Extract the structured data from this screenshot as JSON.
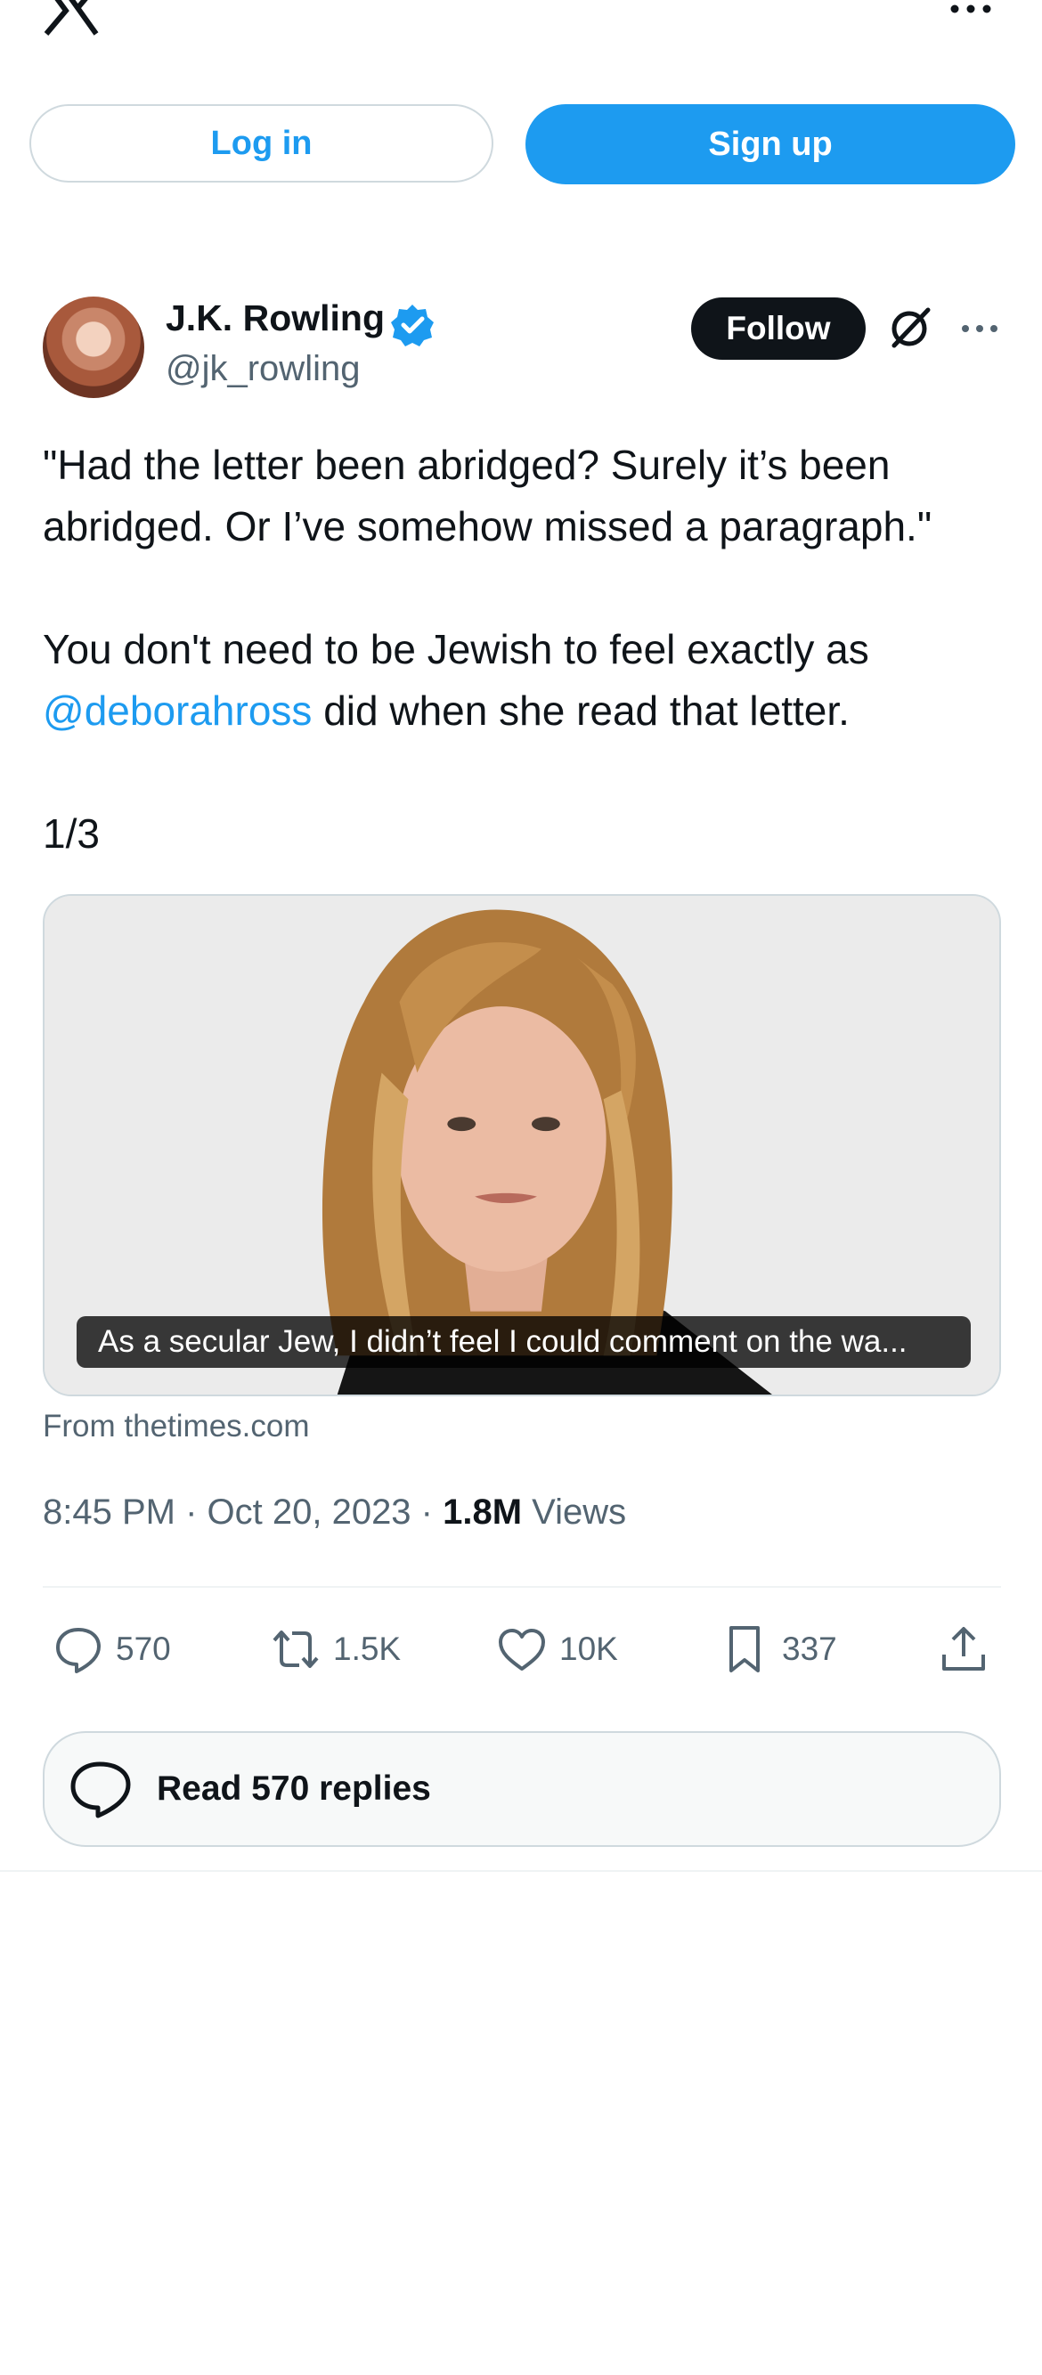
{
  "top_bar": {
    "logo_icon": "x-logo-icon",
    "more_icon": "more-horizontal-icon",
    "login_label": "Log in",
    "signup_label": "Sign up",
    "accent_color": "#1d9bf0"
  },
  "tweet": {
    "author_name": "J.K. Rowling",
    "handle": "@jk_rowling",
    "verified_icon": "verified-badge-icon",
    "follow_label": "Follow",
    "grok_icon": "grok-icon",
    "more_icon": "more-horizontal-icon",
    "text_line1": "\"Had the letter been abridged? Surely it’s been abridged. Or I’ve somehow missed a paragraph.\"",
    "text_line2_prefix": "You don't need to be Jewish to feel exactly as ",
    "mention": "@deborahross",
    "text_line2_suffix": " did when she read that letter.",
    "thread_marker": "1/3",
    "card_caption": "As a secular Jew, I didn’t feel I could comment on the wa...",
    "card_source": "From thetimes.com",
    "time": "8:45 PM · Oct 20, 2023 · ",
    "views_count": "1.8M",
    "views_label": " Views"
  },
  "actions": {
    "replies": "570",
    "retweets": "1.5K",
    "likes": "10K",
    "bookmarks": "337",
    "reply_icon": "reply-bubble-icon",
    "retweet_icon": "retweet-icon",
    "like_icon": "heart-icon",
    "bookmark_icon": "bookmark-icon",
    "share_icon": "share-upload-icon"
  },
  "read_replies_label": "Read 570 replies"
}
